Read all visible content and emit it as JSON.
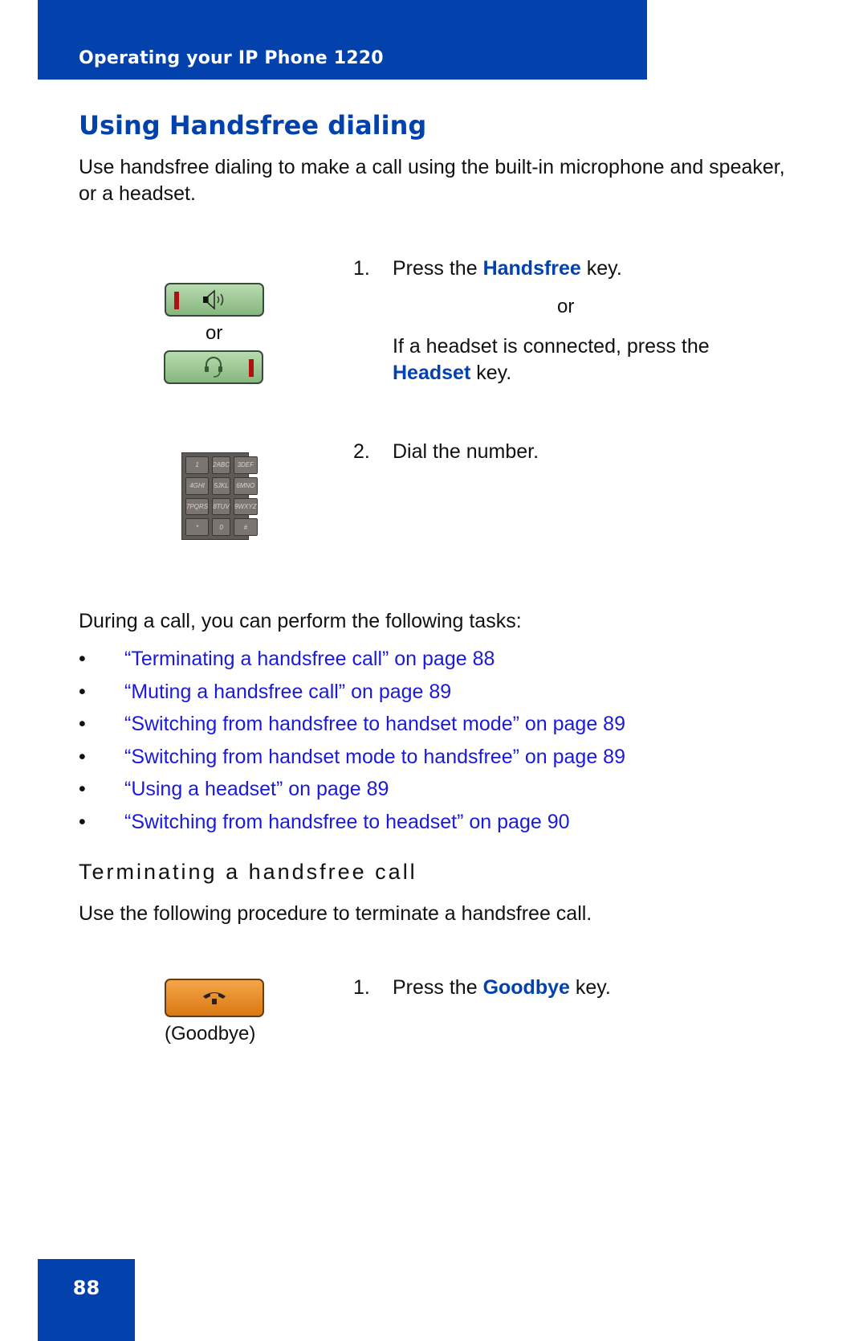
{
  "header": {
    "title": "Operating your IP Phone 1220",
    "color": "#0341ac"
  },
  "page_title": "Using Handsfree dialing",
  "intro": "Use handsfree dialing to make a call using the built-in microphone and speaker, or a headset.",
  "dial_steps": {
    "image_or_label": "or",
    "step1": {
      "number": "1.",
      "prefix": "Press the",
      "keyword": "Handsfree",
      "suffix": "key.",
      "or_label": "or",
      "alt_prefix": "If a headset is connected, press the",
      "alt_keyword": "Headset",
      "alt_suffix": "key."
    },
    "step2": {
      "number": "2.",
      "text": "Dial the number."
    },
    "keypad_keys": [
      "1",
      "2ABC",
      "3DEF",
      "4GHI",
      "5JKL",
      "6MNO",
      "7PQRS",
      "8TUV",
      "9WXYZ",
      "*",
      "0",
      "#"
    ]
  },
  "tasks_intro": "During a call, you can perform the following tasks:",
  "bullet_symbol": "•",
  "tasks": [
    "“Terminating a handsfree call” on page 88",
    "“Muting a handsfree call” on page 89",
    "“Switching from handsfree to handset mode” on page 89",
    "“Switching from handset mode to handsfree” on page 89",
    "“Using a headset” on page 89",
    "“Switching from handsfree to headset” on page 90"
  ],
  "terminate_section": {
    "heading": "Terminating a handsfree call",
    "intro": "Use the following procedure to terminate a handsfree call.",
    "key_caption": "(Goodbye)",
    "step1": {
      "number": "1.",
      "prefix": "Press the",
      "keyword": "Goodbye",
      "suffix": "key."
    }
  },
  "footer": {
    "page_number": "88"
  }
}
